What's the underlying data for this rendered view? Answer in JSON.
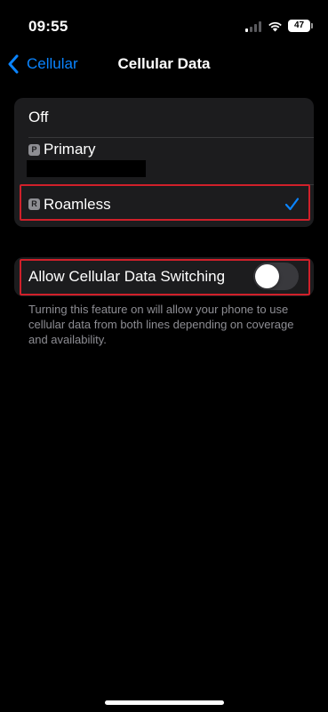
{
  "status_bar": {
    "time": "09:55",
    "battery_level": "47"
  },
  "nav": {
    "back_label": "Cellular",
    "title": "Cellular Data"
  },
  "options": {
    "off_label": "Off",
    "primary_badge": "P",
    "primary_label": "Primary",
    "roamless_badge": "R",
    "roamless_label": "Roamless",
    "selected": "Roamless"
  },
  "switching": {
    "label": "Allow Cellular Data Switching",
    "enabled": false,
    "footnote": "Turning this feature on will allow your phone to use cellular data from both lines depending on coverage and availability."
  },
  "colors": {
    "accent": "#0a84ff",
    "highlight": "#d0202a",
    "group_bg": "#1c1c1e"
  }
}
